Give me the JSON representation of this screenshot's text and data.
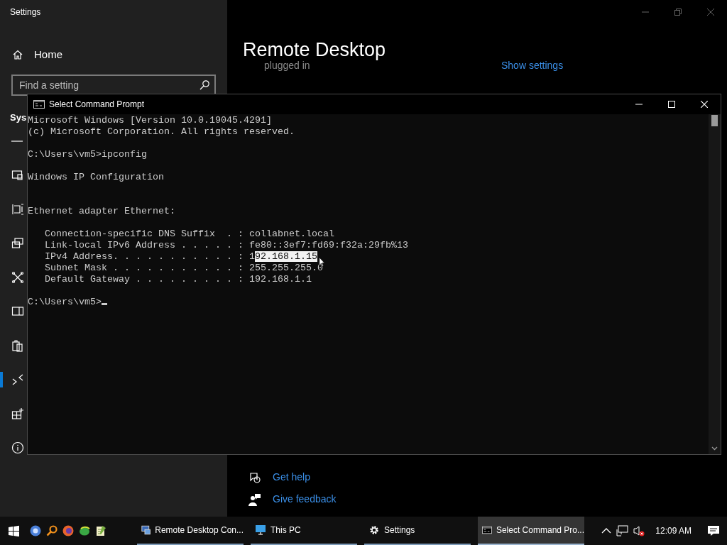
{
  "settings_window": {
    "title": "Settings",
    "home": "Home",
    "search": {
      "placeholder": "Find a setting"
    },
    "section_heading": "Sys",
    "sidebar_items": [
      {
        "selected": false
      },
      {
        "selected": false
      },
      {
        "selected": false
      },
      {
        "selected": false
      },
      {
        "selected": false
      },
      {
        "selected": false
      },
      {
        "selected": false
      },
      {
        "selected": true
      },
      {
        "selected": false
      },
      {
        "selected": false
      }
    ],
    "page_title": "Remote Desktop",
    "partial_text": "plugged in",
    "show_settings_link": "Show settings",
    "help_links": [
      "Get help",
      "Give feedback"
    ]
  },
  "command_prompt": {
    "title": "Select Command Prompt",
    "lines": [
      {
        "kind": "text",
        "text": "Microsoft Windows [Version 10.0.19045.4291]"
      },
      {
        "kind": "text",
        "text": "(c) Microsoft Corporation. All rights reserved."
      },
      {
        "kind": "blank"
      },
      {
        "kind": "text",
        "text": "C:\\Users\\vm5>ipconfig"
      },
      {
        "kind": "blank"
      },
      {
        "kind": "text",
        "text": "Windows IP Configuration"
      },
      {
        "kind": "blank"
      },
      {
        "kind": "blank"
      },
      {
        "kind": "text",
        "text": "Ethernet adapter Ethernet:"
      },
      {
        "kind": "blank"
      },
      {
        "kind": "text",
        "text": "   Connection-specific DNS Suffix  . : collabnet.local"
      },
      {
        "kind": "text",
        "text": "   Link-local IPv6 Address . . . . . : fe80::3ef7:fd69:f32a:29fb%13"
      },
      {
        "kind": "segments",
        "segments": [
          {
            "text": "   IPv4 Address. . . . . . . . . . . : 1",
            "selected": false
          },
          {
            "text": "92.168.1.15",
            "selected": true
          }
        ]
      },
      {
        "kind": "text",
        "text": "   Subnet Mask . . . . . . . . . . . : 255.255.255.0"
      },
      {
        "kind": "text",
        "text": "   Default Gateway . . . . . . . . . : 192.168.1.1"
      },
      {
        "kind": "blank"
      },
      {
        "kind": "prompt",
        "text": "C:\\Users\\vm5>"
      }
    ]
  },
  "taskbar": {
    "tasks": [
      {
        "label": "Remote Desktop Con...",
        "selected": false
      },
      {
        "label": "This PC",
        "selected": false
      },
      {
        "label": "Settings",
        "selected": false
      },
      {
        "label": "Select Command Pro...",
        "selected": true
      }
    ],
    "clock": "12:09 AM"
  }
}
